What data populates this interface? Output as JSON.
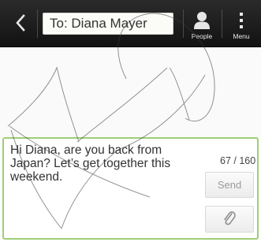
{
  "header": {
    "to_field": "To: Diana Mayer",
    "people_label": "People",
    "menu_label": "Menu"
  },
  "compose": {
    "message_text": "Hi Diana, are you back from Japan? Let’s get together this weekend.",
    "char_count": "67 / 160",
    "send_label": "Send"
  },
  "icons": {
    "back": "chevron-left-icon",
    "people": "person-icon",
    "menu": "vertical-dots-icon",
    "attach": "paperclip-icon"
  },
  "colors": {
    "topbar": "#1f1f1f",
    "compose_border": "#9dcf74",
    "text": "#333333",
    "send_text": "#9b9b9b"
  }
}
